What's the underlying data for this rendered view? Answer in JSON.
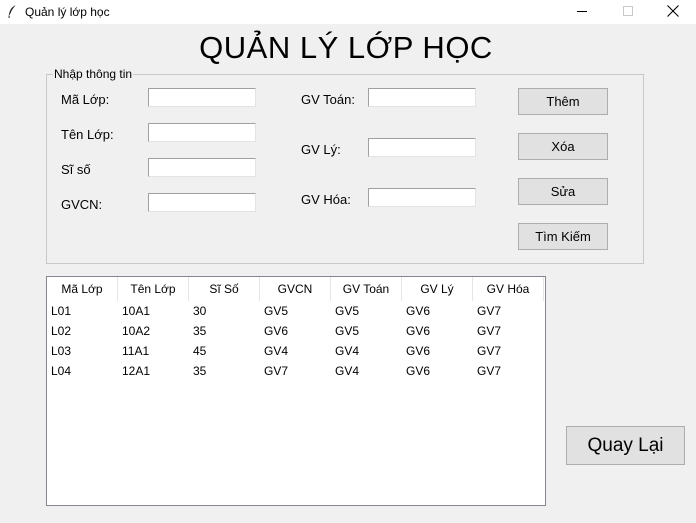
{
  "window": {
    "title": "Quản lý lớp học"
  },
  "header": {
    "title": "QUẢN LÝ LỚP HỌC"
  },
  "form": {
    "group_label": "Nhập thông tin",
    "ma_lop_label": "Mã Lớp:",
    "ten_lop_label": "Tên Lớp:",
    "si_so_label": "Sĩ số",
    "gvcn_label": "GVCN:",
    "gv_toan_label": "GV Toán:",
    "gv_ly_label": "GV Lý:",
    "gv_hoa_label": "GV Hóa:",
    "ma_lop_value": "",
    "ten_lop_value": "",
    "si_so_value": "",
    "gvcn_value": "",
    "gv_toan_value": "",
    "gv_ly_value": "",
    "gv_hoa_value": ""
  },
  "buttons": {
    "them": "Thêm",
    "xoa": "Xóa",
    "sua": "Sửa",
    "tim_kiem": "Tìm Kiếm",
    "quay_lai": "Quay Lại"
  },
  "table": {
    "columns": [
      "Mã Lớp",
      "Tên Lớp",
      "Sĩ Số",
      "GVCN",
      "GV Toán",
      "GV Lý",
      "GV Hóa"
    ],
    "rows": [
      [
        "L01",
        "10A1",
        "30",
        "GV5",
        "GV5",
        "GV6",
        "GV7"
      ],
      [
        "L02",
        "10A2",
        "35",
        "GV6",
        "GV5",
        "GV6",
        "GV7"
      ],
      [
        "L03",
        "11A1",
        "45",
        "GV4",
        "GV4",
        "GV6",
        "GV7"
      ],
      [
        "L04",
        "12A1",
        "35",
        "GV7",
        "GV4",
        "GV6",
        "GV7"
      ]
    ]
  }
}
